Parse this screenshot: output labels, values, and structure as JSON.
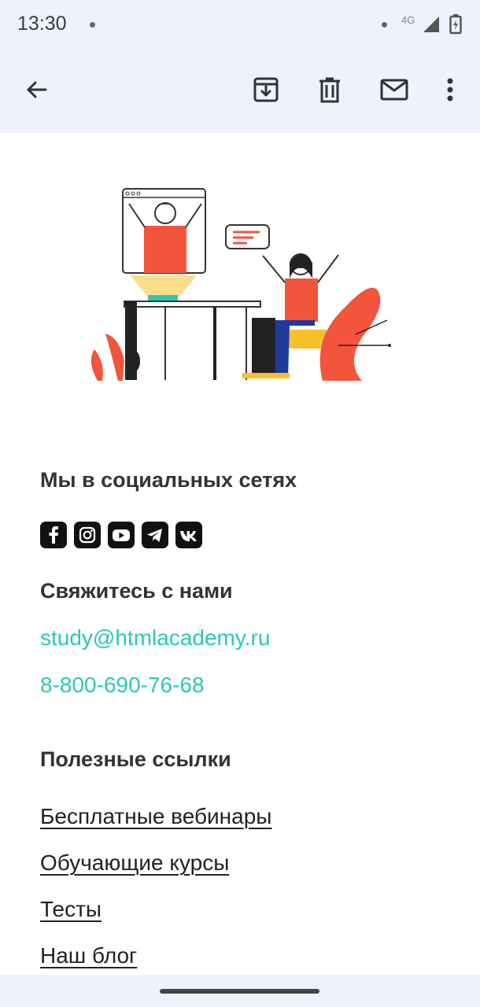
{
  "status_bar": {
    "time": "13:30",
    "network": "4G"
  },
  "app_bar": {
    "icons": [
      "back-arrow-icon",
      "archive-icon",
      "trash-icon",
      "mail-icon",
      "more-vert-icon"
    ]
  },
  "social": {
    "heading": "Мы в социальных сетях",
    "icons": [
      "facebook-icon",
      "instagram-icon",
      "youtube-icon",
      "telegram-icon",
      "vk-icon"
    ]
  },
  "contact": {
    "heading": "Свяжитесь с нами",
    "email": "study@htmlacademy.ru",
    "phone": "8-800-690-76-68"
  },
  "links": {
    "heading": "Полезные ссылки",
    "items": [
      "Бесплатные вебинары",
      "Обучающие курсы",
      "Тесты",
      "Наш блог"
    ]
  },
  "colors": {
    "accent": "#2dc8b3",
    "bar_bg": "#eef2fa",
    "illustration_red": "#f2553c",
    "illustration_yellow": "#f7c12a"
  }
}
